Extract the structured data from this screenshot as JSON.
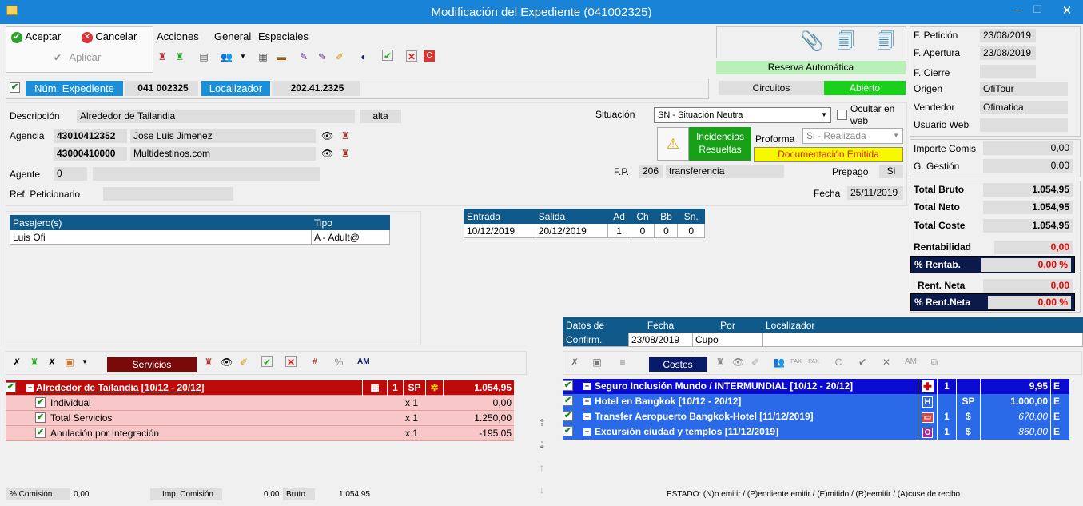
{
  "window": {
    "title": "Modificación del Expediente (041002325)"
  },
  "toolbar": {
    "accept": "Aceptar",
    "cancel": "Cancelar",
    "apply": "Aplicar",
    "menu_acciones": "Acciones",
    "menu_general": "General",
    "menu_especiales": "Especiales"
  },
  "status_top": {
    "reserva": "Reserva Automática",
    "circuitos": "Circuitos",
    "abierto": "Abierto"
  },
  "dates_right": {
    "f_peticion_label": "F. Petición",
    "f_peticion": "23/08/2019",
    "f_apertura_label": "F. Apertura",
    "f_apertura": "23/08/2019",
    "f_cierre_label": "F. Cierre",
    "f_cierre": "",
    "origen_label": "Origen",
    "origen": "OfiTour",
    "vendedor_label": "Vendedor",
    "vendedor": "Ofimatica",
    "usuario_label": "Usuario Web",
    "usuario": ""
  },
  "expediente": {
    "num_label": "Núm. Expediente",
    "num": "041 002325",
    "loc_label": "Localizador",
    "loc": "202.41.2325"
  },
  "form": {
    "desc_label": "Descripción",
    "desc": "Alrededor de Tailandia",
    "alta": "alta",
    "agencia_label": "Agencia",
    "ag1_code": "43010412352",
    "ag1_name": "Jose Luis Jimenez",
    "ag2_code": "43000410000",
    "ag2_name": "Multidestinos.com",
    "agente_label": "Agente",
    "agente_code": "0",
    "ref_label": "Ref. Peticionario",
    "situacion_label": "Situación",
    "situacion": "SN - Situación Neutra",
    "ocultar": "Ocultar en web",
    "incidencias": "Incidencias Resueltas",
    "proforma_label": "Proforma",
    "proforma": "Si - Realizada",
    "doc_emitida": "Documentación Emitida",
    "fp_label": "F.P.",
    "fp_code": "206",
    "fp": "transferencia",
    "prepago_label": "Prepago",
    "prepago": "Si",
    "fecha_label": "Fecha",
    "fecha": "25/11/2019"
  },
  "totals": {
    "importe_comis_label": "Importe Comis",
    "importe_comis": "0,00",
    "gestion_label": "G. Gestión",
    "gestion": "0,00",
    "bruto_label": "Total Bruto",
    "bruto": "1.054,95",
    "neto_label": "Total Neto",
    "neto": "1.054,95",
    "coste_label": "Total Coste",
    "coste": "1.054,95",
    "rent_label": "Rentabilidad",
    "rent": "0,00",
    "prent_label": "% Rentab.",
    "prent": "0,00 %",
    "rneta_label": "Rent. Neta",
    "rneta": "0,00",
    "prneta_label": "% Rent.Neta",
    "prneta": "0,00 %"
  },
  "pasajeros": {
    "h1": "Pasajero(s)",
    "h2": "Tipo",
    "rows": [
      {
        "name": "Luis Ofi",
        "tipo": "A - Adult@"
      }
    ]
  },
  "estancia": {
    "headers": [
      "Entrada",
      "Salida",
      "Ad",
      "Ch",
      "Bb",
      "Sn."
    ],
    "row": [
      "10/12/2019",
      "20/12/2019",
      "1",
      "0",
      "0",
      "0"
    ]
  },
  "servicios": {
    "label": "Servicios",
    "main": {
      "name": "Alrededor de Tailandia [10/12 - 20/12]",
      "qty": "1",
      "type": "SP",
      "amount": "1.054,95"
    },
    "rows": [
      {
        "name": "Individual",
        "qty": "x 1",
        "amount": "0,00"
      },
      {
        "name": "Total Servicios",
        "qty": "x 1",
        "amount": "1.250,00"
      },
      {
        "name": "Anulación por Integración",
        "qty": "x 1",
        "amount": "-195,05"
      }
    ]
  },
  "datos": {
    "h1": "Datos de",
    "h2": "Fecha",
    "h3": "Por",
    "h4": "Localizador",
    "r1": "Confirm.",
    "r2": "23/08/2019",
    "r3": "Cupo",
    "r4": ""
  },
  "costes": {
    "label": "Costes",
    "rows": [
      {
        "name": "Seguro Inclusión Mundo / INTERMUNDIAL [10/12 - 20/12]",
        "qty": "1",
        "type": "",
        "amount": "9,95",
        "cur": "E"
      },
      {
        "name": "Hotel en Bangkok [10/12 - 20/12]",
        "qty": "",
        "type": "SP",
        "amount": "1.000,00",
        "cur": "E"
      },
      {
        "name": "Transfer Aeropuerto Bangkok-Hotel [11/12/2019]",
        "qty": "1",
        "type": "",
        "amount": "670,00",
        "cur": "E"
      },
      {
        "name": "Excursión ciudad y templos [11/12/2019]",
        "qty": "1",
        "type": "",
        "amount": "860,00",
        "cur": "E"
      }
    ]
  },
  "footer": {
    "comision_label": "% Comisión",
    "comision": "0,00",
    "imp_label": "Imp. Comisión",
    "imp": "0,00",
    "bruto_label": "Bruto",
    "bruto": "1.054,95",
    "estado": "ESTADO: (N)o emitir / (P)endiente emitir / (E)mitido / (R)eemitir / (A)cuse de recibo"
  }
}
